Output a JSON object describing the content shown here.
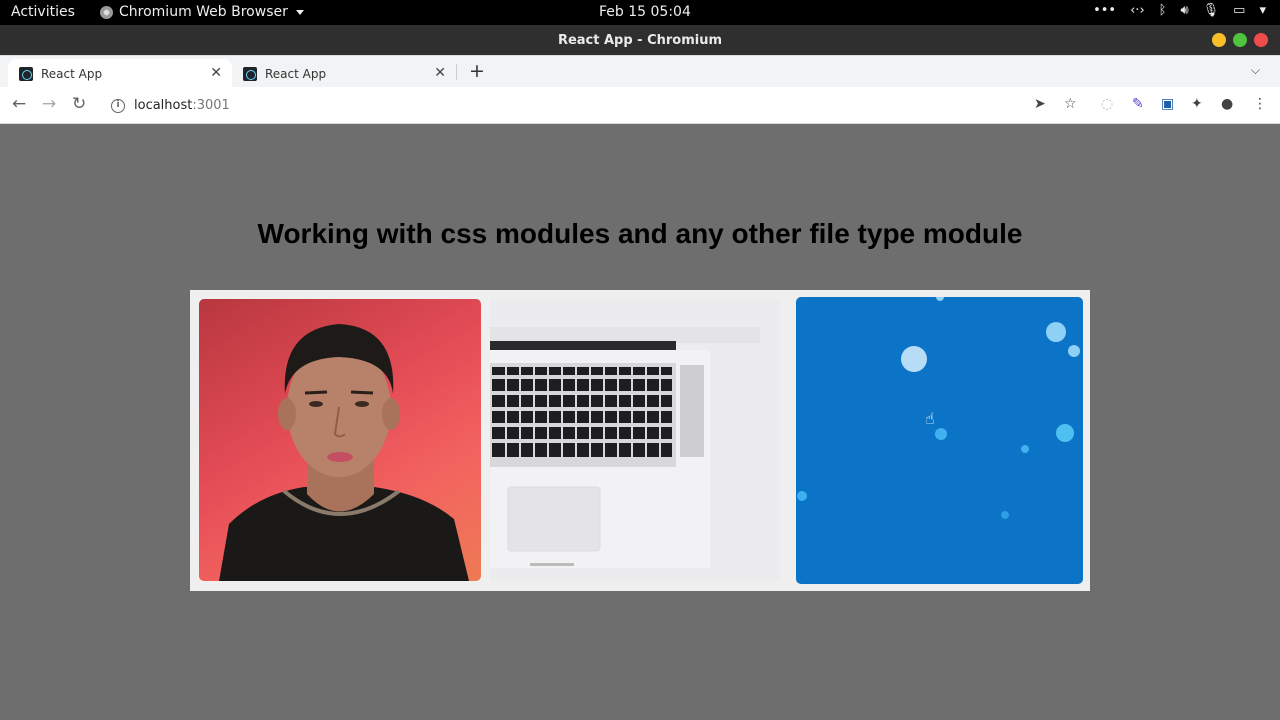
{
  "system_bar": {
    "activities": "Activities",
    "app_name": "Chromium Web Browser",
    "clock": "Feb 15  05:04"
  },
  "window": {
    "title": "React App - Chromium"
  },
  "tabs": [
    {
      "label": "React App",
      "active": true
    },
    {
      "label": "React App",
      "active": false
    }
  ],
  "address_bar": {
    "host": "localhost",
    "port": ":3001"
  },
  "page": {
    "heading": "Working with css modules and any other file type module"
  },
  "gallery": {
    "images": [
      {
        "name": "portrait-photo",
        "subject": "young man with dark hair on red-orange background"
      },
      {
        "name": "laptop-photo",
        "subject": "top-down view of a silver laptop keyboard"
      },
      {
        "name": "bubbles-image",
        "subject": "light blue bubbles on a blue background"
      }
    ]
  },
  "colors": {
    "page_background": "#6e6e6e",
    "gallery_background": "#efefef",
    "bubbles_background": "#0c74c7"
  }
}
